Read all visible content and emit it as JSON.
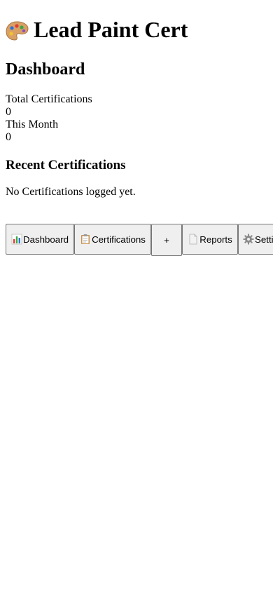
{
  "app": {
    "title": "Lead Paint Cert",
    "logo_icon": "palette-icon"
  },
  "page": {
    "title": "Dashboard"
  },
  "stats": [
    {
      "label": "Total Certifications",
      "value": "0"
    },
    {
      "label": "This Month",
      "value": "0"
    }
  ],
  "recent": {
    "title": "Recent Certifications",
    "empty_message": "No Certifications logged yet."
  },
  "nav": {
    "dashboard": {
      "label": "Dashboard",
      "icon": "bar-chart-icon"
    },
    "certifications": {
      "label": "Certifications",
      "icon": "clipboard-icon"
    },
    "add": {
      "label": "+"
    },
    "reports": {
      "label": "Reports",
      "icon": "document-icon"
    },
    "settings": {
      "label": "Settings",
      "icon": "gear-icon"
    }
  }
}
